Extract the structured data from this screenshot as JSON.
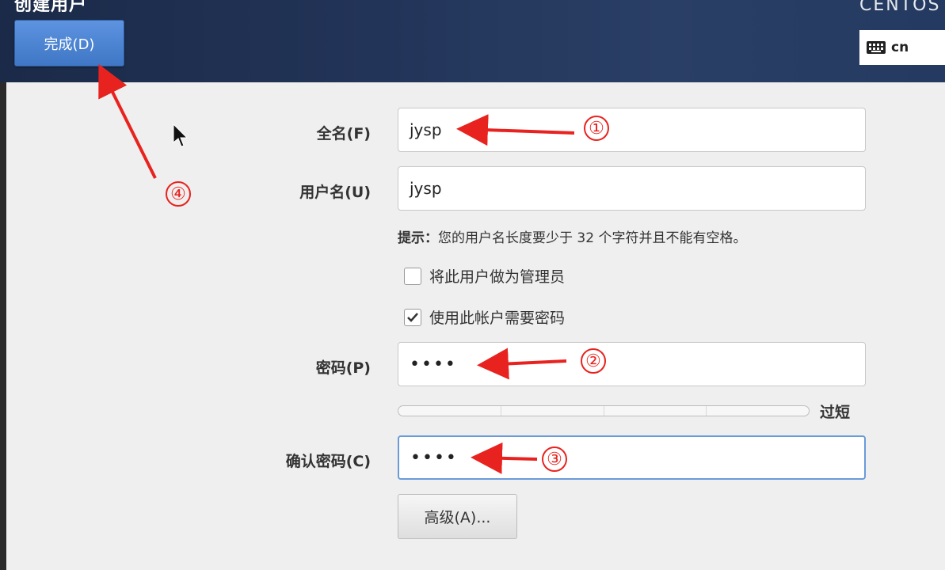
{
  "header": {
    "title": "创建用户",
    "done_label": "完成(D)",
    "product": "CENTOS",
    "keyboard_layout": "cn"
  },
  "form": {
    "fullname_label": "全名(F)",
    "fullname_value": "jysp",
    "username_label": "用户名(U)",
    "username_value": "jysp",
    "hint_bold": "提示：",
    "hint_text": "您的用户名长度要少于 32 个字符并且不能有空格。",
    "admin_checkbox_label": "将此用户做为管理员",
    "admin_checked": false,
    "require_password_label": "使用此帐户需要密码",
    "require_password_checked": true,
    "password_label": "密码(P)",
    "password_value": "••••",
    "strength_label": "过短",
    "confirm_label": "确认密码(C)",
    "confirm_value": "••••",
    "advanced_label": "高级(A)..."
  },
  "annotations": {
    "step1": "①",
    "step2": "②",
    "step3": "③",
    "step4": "④",
    "color": "#e8231f"
  }
}
